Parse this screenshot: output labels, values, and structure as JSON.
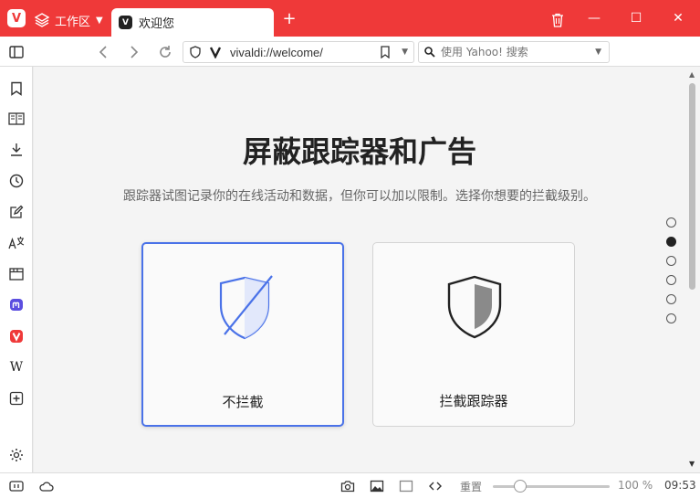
{
  "titlebar": {
    "logo_letter": "V",
    "workspace_label": "工作区",
    "tab_title": "欢迎您",
    "new_tab": "+",
    "minimize": "—",
    "maximize": "☐",
    "close": "✕"
  },
  "addressbar": {
    "url": "vivaldi://welcome/",
    "search_placeholder": "使用 Yahoo! 搜索"
  },
  "content": {
    "heading": "屏蔽跟踪器和广告",
    "subtitle": "跟踪器试图记录你的在线活动和数据，但你可以加以限制。选择你想要的拦截级别。",
    "options": [
      {
        "label": "不拦截",
        "selected": true
      },
      {
        "label": "拦截跟踪器",
        "selected": false
      }
    ],
    "pagination": {
      "total": 6,
      "active_index": 1
    }
  },
  "sidepanel": {
    "items": [
      "bookmarks-icon",
      "reading-list-icon",
      "downloads-icon",
      "history-icon",
      "notes-icon",
      "translate-icon",
      "window-icon",
      "mastodon-icon",
      "vivaldi-icon",
      "wikipedia-icon",
      "add-panel-icon",
      "settings-icon"
    ],
    "wikipedia_letter": "W"
  },
  "statusbar": {
    "reset_label": "重置",
    "zoom": "100 %",
    "zoom_level": 0.2,
    "time": "09:53"
  },
  "colors": {
    "accent": "#ef3939",
    "selection": "#4a72e8"
  }
}
